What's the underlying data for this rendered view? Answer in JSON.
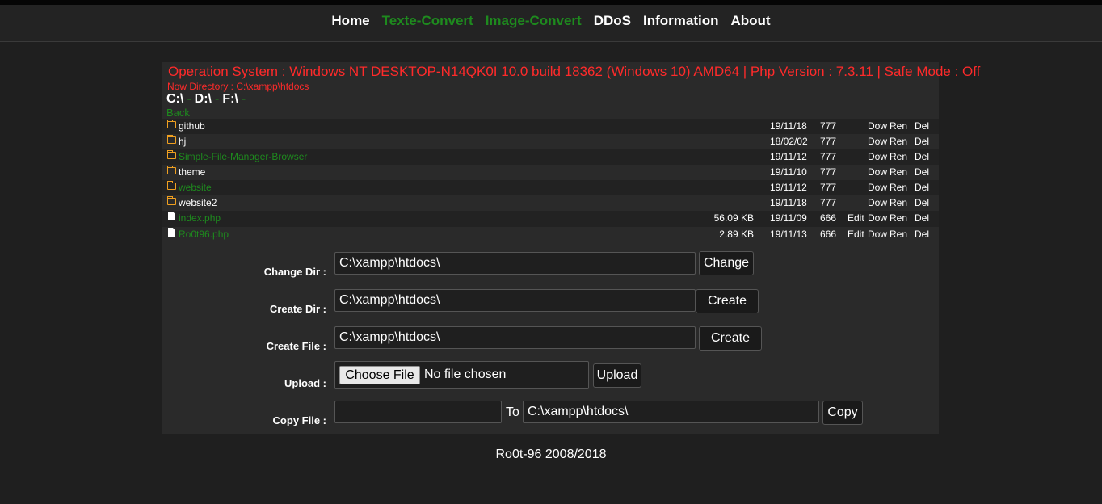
{
  "nav": [
    {
      "label": "Home",
      "color": "#ffffff"
    },
    {
      "label": "Texte-Convert",
      "color": "#1e8a1e"
    },
    {
      "label": "Image-Convert",
      "color": "#1e8a1e"
    },
    {
      "label": "DDoS",
      "color": "#ffffff"
    },
    {
      "label": "Information",
      "color": "#ffffff"
    },
    {
      "label": "About",
      "color": "#ffffff"
    }
  ],
  "sysinfo": "Operation System : Windows NT DESKTOP-N14QK0I 10.0 build 18362 (Windows 10) AMD64 | Php Version : 7.3.11 | Safe Mode : Off",
  "now_directory": "Now Directory : C:\\xampp\\htdocs",
  "drives": [
    "C:\\",
    "D:\\",
    "F:\\"
  ],
  "drive_separator": "-",
  "back_label": "Back",
  "entries": [
    {
      "type": "folder",
      "name": "github",
      "size": "",
      "date": "19/11/18",
      "perm": "777",
      "green": false
    },
    {
      "type": "folder",
      "name": "hj",
      "size": "",
      "date": "18/02/02",
      "perm": "777",
      "green": false
    },
    {
      "type": "folder",
      "name": "Simple-File-Manager-Browser",
      "size": "",
      "date": "19/11/12",
      "perm": "777",
      "green": true
    },
    {
      "type": "folder",
      "name": "theme",
      "size": "",
      "date": "19/11/10",
      "perm": "777",
      "green": false
    },
    {
      "type": "folder",
      "name": "website",
      "size": "",
      "date": "19/11/12",
      "perm": "777",
      "green": true
    },
    {
      "type": "folder",
      "name": "website2",
      "size": "",
      "date": "19/11/18",
      "perm": "777",
      "green": false
    },
    {
      "type": "file",
      "name": "index.php",
      "size": "56.09 KB",
      "date": "19/11/09",
      "perm": "666",
      "green": true
    },
    {
      "type": "file",
      "name": "Ro0t96.php",
      "size": "2.89 KB",
      "date": "19/11/13",
      "perm": "666",
      "green": true
    }
  ],
  "actions": {
    "edit": "Edit",
    "download": "Dow",
    "rename": "Ren",
    "delete": "Del"
  },
  "forms": {
    "change_dir": {
      "label": "Change Dir :",
      "value": "C:\\xampp\\htdocs\\",
      "button": "Change"
    },
    "create_dir": {
      "label": "Create Dir :",
      "value": "C:\\xampp\\htdocs\\",
      "button": "Create"
    },
    "create_file": {
      "label": "Create File :",
      "value": "C:\\xampp\\htdocs\\",
      "button": "Create"
    },
    "upload": {
      "label": "Upload :",
      "choose": "Choose File",
      "nofile": "No file chosen",
      "button": "Upload"
    },
    "copy_file": {
      "label": "Copy File :",
      "source": "",
      "to": "To",
      "dest": "C:\\xampp\\htdocs\\",
      "button": "Copy"
    }
  },
  "footer": "Ro0t-96 2008/2018"
}
